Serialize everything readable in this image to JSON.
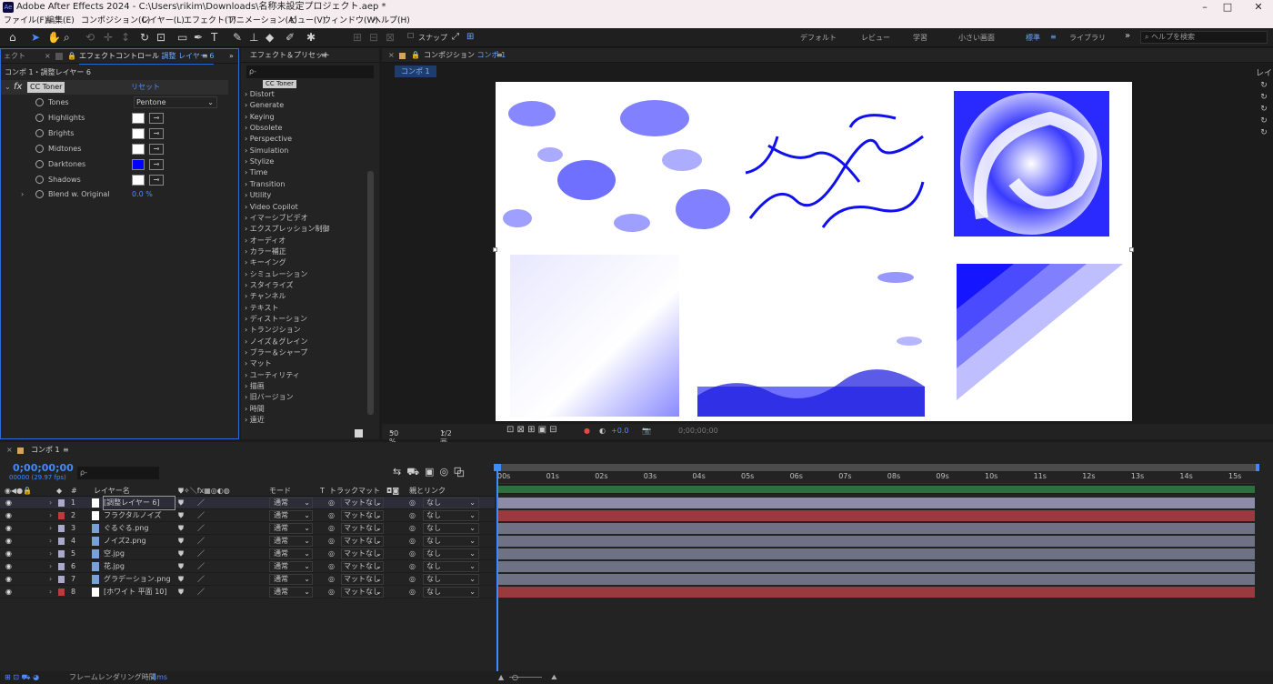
{
  "window": {
    "title": "Adobe After Effects 2024 - C:\\Users\\rikim\\Downloads\\名称未設定プロジェクト.aep *",
    "app_logo": "Ae",
    "minimize": "–",
    "maximize": "□",
    "close": "✕"
  },
  "menu": [
    "ファイル(F)",
    "編集(E)",
    "コンポジション(C)",
    "レイヤー(L)",
    "エフェクト(T)",
    "アニメーション(A)",
    "ビュー(V)",
    "ウィンドウ(W)",
    "ヘルプ(H)"
  ],
  "toolbar": {
    "snap_label": "スナップ",
    "workspaces": [
      "デフォルト",
      "レビュー",
      "学習",
      "小さい画面",
      "標準",
      "ライブラリ"
    ],
    "active_workspace": "標準",
    "more": "»",
    "help_placeholder": "ヘルプを検索"
  },
  "effect_controls": {
    "left_tab": "ェクト",
    "tab_label": "エフェクトコントロール",
    "tab_layer": "調整 レイヤー 6",
    "breadcrumb": "コンポ 1・調整レイヤー 6",
    "effect_name": "CC Toner",
    "fx_label": "fx",
    "reset_label": "リセット",
    "tones_label": "Tones",
    "tones_value": "Pentone",
    "params": [
      {
        "name": "Highlights",
        "color": "#ffffff"
      },
      {
        "name": "Brights",
        "color": "#ffffff"
      },
      {
        "name": "Midtones",
        "color": "#ffffff"
      },
      {
        "name": "Darktones",
        "color": "#0000ff"
      },
      {
        "name": "Shadows",
        "color": "#ffffff"
      }
    ],
    "blend_label": "Blend w. Original",
    "blend_value": "0.0 %"
  },
  "fx_presets": {
    "title": "エフェクト＆プリセット",
    "search_placeholder": "ρ-",
    "first_item": "CC Toner",
    "items": [
      "Distort",
      "Generate",
      "Keying",
      "Obsolete",
      "Perspective",
      "Simulation",
      "Stylize",
      "Time",
      "Transition",
      "Utility",
      "Video Copilot",
      "イマーシブビデオ",
      "エクスプレッション制御",
      "オーディオ",
      "カラー補正",
      "キーイング",
      "シミュレーション",
      "スタイライズ",
      "チャンネル",
      "テキスト",
      "ディストーション",
      "トランジション",
      "ノイズ＆グレイン",
      "ブラー＆シャープ",
      "マット",
      "ユーティリティ",
      "描画",
      "旧バージョン",
      "時間",
      "遠近"
    ]
  },
  "composition": {
    "tab_prefix": "コンポジション",
    "tab_name": "コンポ 1",
    "subtab": "コンポ 1",
    "zoom": "50 %",
    "resolution": "1/2 画質",
    "exposure": "+0.0",
    "timecode": "0;00;00;00"
  },
  "right_strip": {
    "label": "レイ"
  },
  "timeline": {
    "tab": "コンポ 1",
    "timecode": "0;00;00;00",
    "fps": "00000 (29.97 fps)",
    "search_placeholder": "ρ-",
    "col_layer_name": "レイヤー名",
    "col_mode": "モード",
    "col_t": "T",
    "col_trackmatte": "トラックマット",
    "col_parent": "親とリンク",
    "col_num": "#",
    "layers": [
      {
        "index": "1",
        "name": "[調整レイヤー 6]",
        "label_color": "#a9a9c9",
        "mode": "通常",
        "matte": "マットなし",
        "parent": "なし",
        "bar": "#8c8ca8"
      },
      {
        "index": "2",
        "name": "フラクタルノイズ",
        "label_color": "#c0393b",
        "mode": "通常",
        "matte": "マットなし",
        "parent": "なし",
        "bar": "#9a3a3e"
      },
      {
        "index": "3",
        "name": "ぐるぐる.png",
        "label_color": "#a9a9c9",
        "mode": "通常",
        "matte": "マットなし",
        "parent": "なし",
        "bar": "#6f7184"
      },
      {
        "index": "4",
        "name": "ノイズ2.png",
        "label_color": "#a9a9c9",
        "mode": "通常",
        "matte": "マットなし",
        "parent": "なし",
        "bar": "#6f7184"
      },
      {
        "index": "5",
        "name": "空.jpg",
        "label_color": "#a9a9c9",
        "mode": "通常",
        "matte": "マットなし",
        "parent": "なし",
        "bar": "#6f7184"
      },
      {
        "index": "6",
        "name": "花.jpg",
        "label_color": "#a9a9c9",
        "mode": "通常",
        "matte": "マットなし",
        "parent": "なし",
        "bar": "#6f7184"
      },
      {
        "index": "7",
        "name": "グラデーション.png",
        "label_color": "#a9a9c9",
        "mode": "通常",
        "matte": "マットなし",
        "parent": "なし",
        "bar": "#6f7184"
      },
      {
        "index": "8",
        "name": "[ホワイト 平面 10]",
        "label_color": "#c0393b",
        "mode": "通常",
        "matte": "マットなし",
        "parent": "なし",
        "bar": "#9a3a3e"
      }
    ],
    "ruler": [
      "00s",
      "01s",
      "02s",
      "03s",
      "04s",
      "05s",
      "06s",
      "07s",
      "08s",
      "09s",
      "10s",
      "11s",
      "12s",
      "13s",
      "14s",
      "15s"
    ],
    "footer_label": "フレームレンダリング時間",
    "footer_value": "4ms"
  }
}
